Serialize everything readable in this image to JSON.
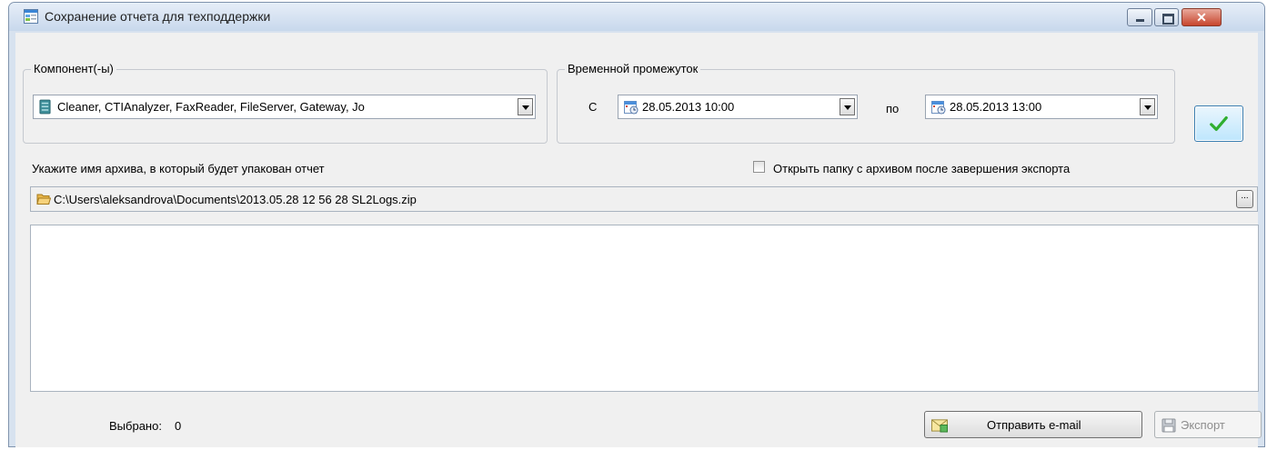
{
  "window": {
    "title": "Сохранение отчета для техподдержки",
    "title_icon": "form-window-icon",
    "controls": {
      "minimize": "minimize-icon",
      "maximize": "maximize-icon",
      "close": "✕"
    }
  },
  "components": {
    "legend": "Компонент(-ы)",
    "icon": "server-icon",
    "value": "Cleaner, CTIAnalyzer, FaxReader, FileServer, Gateway, Jo"
  },
  "time_range": {
    "legend": "Временной промежуток",
    "from_label": "С",
    "from_value": "28.05.2013 10:00",
    "to_label": "по",
    "to_value": "28.05.2013 13:00",
    "calendar_icon": "calendar-icon"
  },
  "confirm_button": {
    "icon": "checkmark-icon"
  },
  "archive": {
    "label": "Укажите имя архива, в который будет упакован отчет",
    "open_folder_label": "Открыть папку с архивом после завершения экспорта",
    "open_folder_checked": false,
    "path": "C:\\Users\\aleksandrova\\Documents\\2013.05.28 12 56 28 SL2Logs.zip",
    "browse_label": "..."
  },
  "log": {
    "content": ""
  },
  "footer": {
    "selected_label": "Выбрано:",
    "selected_count": "0",
    "send_email_label": "Отправить e-mail",
    "export_label": "Экспорт",
    "export_enabled": false
  },
  "colors": {
    "window_frame": "#d7e2ef",
    "client_bg": "#f0f0f0",
    "checkmark": "#2fae2f",
    "close_button": "#c7452d"
  }
}
